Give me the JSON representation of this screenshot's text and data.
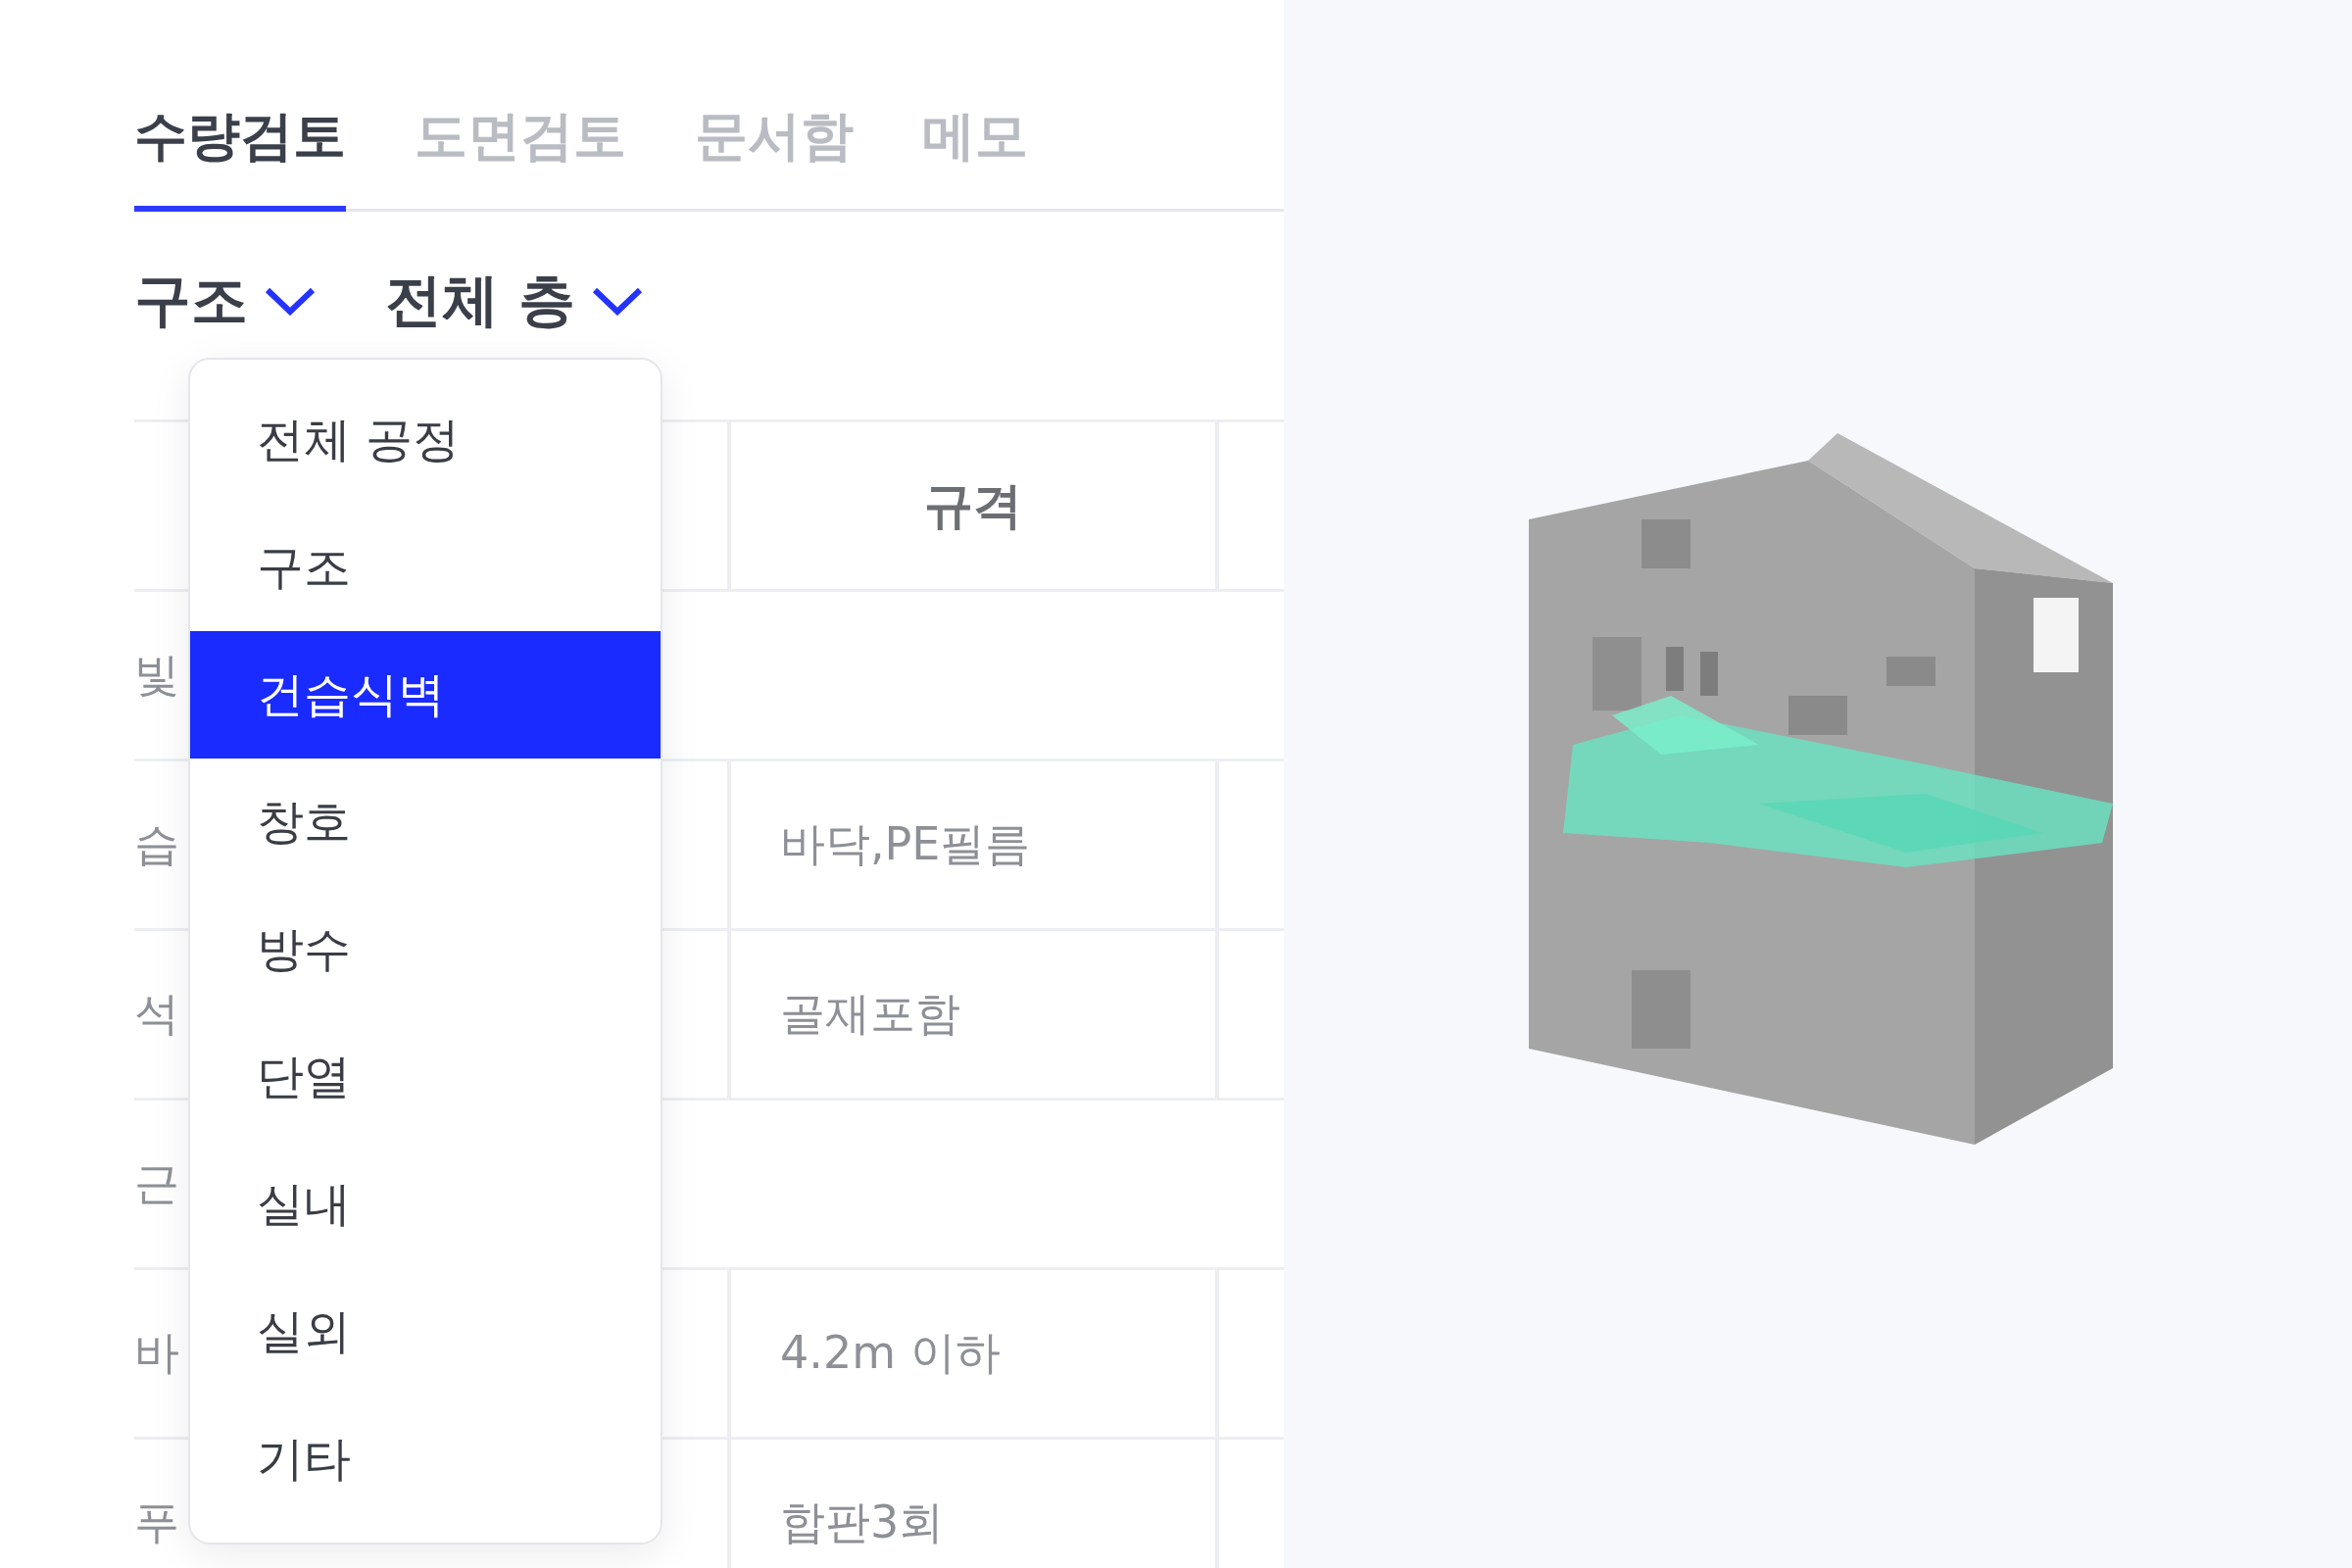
{
  "tabs": [
    {
      "label": "수량검토",
      "selected": true
    },
    {
      "label": "도면검토",
      "selected": false
    },
    {
      "label": "문서함",
      "selected": false
    },
    {
      "label": "메모",
      "selected": false
    }
  ],
  "filters": [
    {
      "label": "구조"
    },
    {
      "label": "전체 층"
    }
  ],
  "menu": {
    "items": [
      {
        "label": "전체 공정",
        "selected": false
      },
      {
        "label": "구조",
        "selected": false
      },
      {
        "label": "건습식벽",
        "selected": true
      },
      {
        "label": "창호",
        "selected": false
      },
      {
        "label": "방수",
        "selected": false
      },
      {
        "label": "단열",
        "selected": false
      },
      {
        "label": "실내",
        "selected": false
      },
      {
        "label": "실외",
        "selected": false
      },
      {
        "label": "기타",
        "selected": false
      }
    ]
  },
  "table": {
    "column_2": "규격",
    "rows": [
      {
        "kind": "group",
        "column_1": "빛"
      },
      {
        "kind": "item",
        "column_1": "습",
        "column_2": "바닥,PE필름"
      },
      {
        "kind": "item",
        "column_1": "석",
        "column_2": "골재포함"
      },
      {
        "kind": "group",
        "column_1": "근"
      },
      {
        "kind": "item",
        "column_1": "바",
        "column_2": "4.2m 이하"
      },
      {
        "kind": "item",
        "column_1": "푸",
        "column_2": "합판3회"
      }
    ]
  }
}
